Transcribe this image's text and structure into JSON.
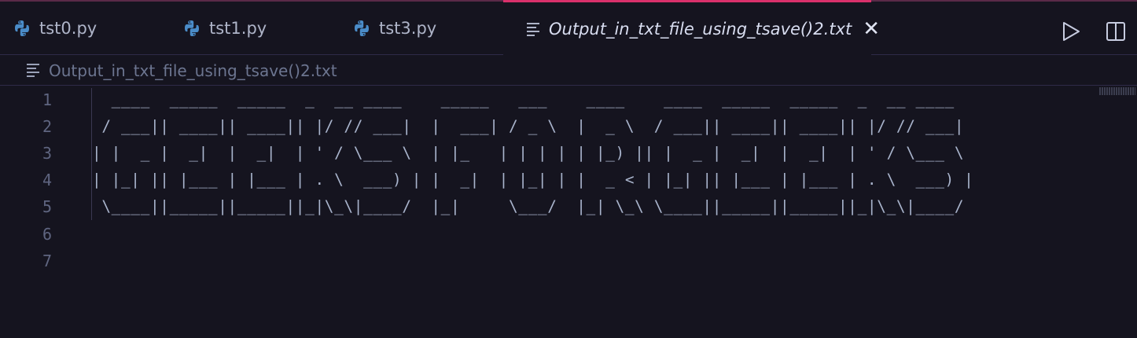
{
  "tabs": [
    {
      "label": "tst0.py",
      "icon": "python-icon",
      "active": false
    },
    {
      "label": "tst1.py",
      "icon": "python-icon",
      "active": false
    },
    {
      "label": "tst3.py",
      "icon": "python-icon",
      "active": false
    },
    {
      "label": "Output_in_txt_file_using_tsave()2.txt",
      "icon": "text-file-icon",
      "active": true
    }
  ],
  "active_tab_close": "✕",
  "breadcrumb": {
    "label": "Output_in_txt_file_using_tsave()2.txt"
  },
  "editor": {
    "line_numbers": [
      "1",
      "2",
      "3",
      "4",
      "5",
      "6",
      "7"
    ],
    "lines": [
      "  ____  _____  _____  _  __ ____    _____   ___    ____    ____  _____  _____  _  __ ____",
      " / ___|| ____|| ____|| |/ // ___|  |  ___| / _ \\  |  _ \\  / ___|| ____|| ____|| |/ // ___|",
      "| |  _ |  _|  |  _|  | ' / \\___ \\  | |_   | | | | | |_) || |  _ |  _|  |  _|  | ' / \\___ \\",
      "| |_| || |___ | |___ | . \\  ___) | |  _|  | |_| | |  _ < | |_| || |___ | |___ | . \\  ___) |",
      " \\____||_____||_____||_|\\_\\|____/  |_|     \\___/  |_| \\_\\ \\____||_____||_____||_|\\_\\|____/",
      "",
      ""
    ]
  },
  "colors": {
    "background": "#15141f",
    "active_tab_accent": "#d9306b",
    "text": "#a9b4cc",
    "python_blue": "#4a8cc8"
  }
}
